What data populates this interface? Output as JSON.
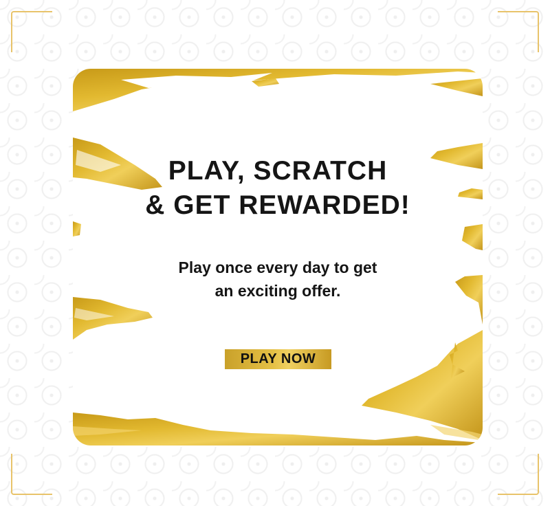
{
  "banner": {
    "title_line1": "PLAY, SCRATCH",
    "title_line2": "& GET REWARDED!",
    "subtitle_line1": "Play once every day to get",
    "subtitle_line2": "an exciting offer.",
    "cta_label": "PLAY NOW"
  },
  "colors": {
    "gold": "#d6aa22",
    "gold_light": "#efce5a",
    "frame": "#e8c36a",
    "text": "#151515",
    "background": "#ffffff"
  },
  "icons": {
    "corner": "gold-corner-bracket"
  }
}
